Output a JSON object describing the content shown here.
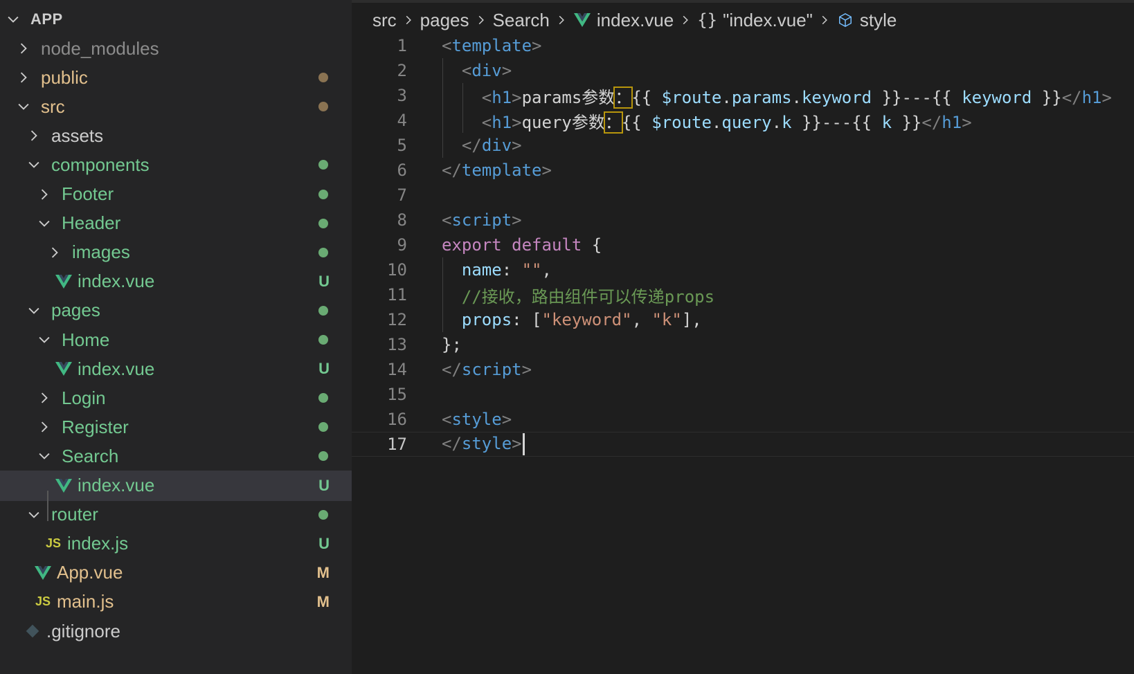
{
  "colors": {
    "untracked_green": "#73c991",
    "modified_tan": "#e2c08d",
    "folder_dot_brown": "#8a7352",
    "selected_bg": "#37373d",
    "vue_green": "#41b883"
  },
  "explorer": {
    "root_label": "APP",
    "items": [
      {
        "label": "node_modules",
        "kind": "folder",
        "expanded": false,
        "depth": 1,
        "color": "#8c8c8c",
        "icon": "chevron-right-icon"
      },
      {
        "label": "public",
        "kind": "folder",
        "expanded": false,
        "depth": 1,
        "color": "#e2c08d",
        "dot": "#8a7352"
      },
      {
        "label": "src",
        "kind": "folder",
        "expanded": true,
        "depth": 1,
        "color": "#e2c08d",
        "dot": "#8a7352"
      },
      {
        "label": "assets",
        "kind": "folder",
        "expanded": false,
        "depth": 2,
        "color": "#cccccc"
      },
      {
        "label": "components",
        "kind": "folder",
        "expanded": true,
        "depth": 2,
        "color": "#73c991",
        "dot": "#6aab73"
      },
      {
        "label": "Footer",
        "kind": "folder",
        "expanded": false,
        "depth": 3,
        "color": "#73c991",
        "dot": "#6aab73"
      },
      {
        "label": "Header",
        "kind": "folder",
        "expanded": true,
        "depth": 3,
        "color": "#73c991",
        "dot": "#6aab73"
      },
      {
        "label": "images",
        "kind": "folder",
        "expanded": false,
        "depth": 4,
        "color": "#73c991",
        "dot": "#6aab73"
      },
      {
        "label": "index.vue",
        "kind": "vue",
        "depth": 4,
        "color": "#73c991",
        "badge": "U"
      },
      {
        "label": "pages",
        "kind": "folder",
        "expanded": true,
        "depth": 2,
        "color": "#73c991",
        "dot": "#6aab73"
      },
      {
        "label": "Home",
        "kind": "folder",
        "expanded": true,
        "depth": 3,
        "color": "#73c991",
        "dot": "#6aab73"
      },
      {
        "label": "index.vue",
        "kind": "vue",
        "depth": 4,
        "color": "#73c991",
        "badge": "U"
      },
      {
        "label": "Login",
        "kind": "folder",
        "expanded": false,
        "depth": 3,
        "color": "#73c991",
        "dot": "#6aab73"
      },
      {
        "label": "Register",
        "kind": "folder",
        "expanded": false,
        "depth": 3,
        "color": "#73c991",
        "dot": "#6aab73"
      },
      {
        "label": "Search",
        "kind": "folder",
        "expanded": true,
        "depth": 3,
        "color": "#73c991",
        "dot": "#6aab73"
      },
      {
        "label": "index.vue",
        "kind": "vue",
        "depth": 4,
        "color": "#73c991",
        "badge": "U",
        "selected": true
      },
      {
        "label": "router",
        "kind": "folder",
        "expanded": true,
        "depth": 2,
        "color": "#73c991",
        "dot": "#6aab73"
      },
      {
        "label": "index.js",
        "kind": "js",
        "depth": 3,
        "color": "#73c991",
        "badge": "U"
      },
      {
        "label": "App.vue",
        "kind": "vue",
        "depth": 2,
        "color": "#e2c08d",
        "badge": "M"
      },
      {
        "label": "main.js",
        "kind": "js",
        "depth": 2,
        "color": "#e2c08d",
        "badge": "M"
      },
      {
        "label": ".gitignore",
        "kind": "git",
        "depth": 1,
        "color": "#cccccc"
      }
    ]
  },
  "breadcrumb": {
    "items": [
      {
        "label": "src",
        "icon": ""
      },
      {
        "label": "pages",
        "icon": ""
      },
      {
        "label": "Search",
        "icon": ""
      },
      {
        "label": "index.vue",
        "icon": "vue-icon"
      },
      {
        "label": "\"index.vue\"",
        "icon": "braces-icon"
      },
      {
        "label": "style",
        "icon": "cube-icon"
      }
    ]
  },
  "editor": {
    "current_line": 17,
    "lines": [
      {
        "n": "1",
        "tokens": [
          [
            "<",
            "t-punct"
          ],
          [
            "template",
            "t-tag"
          ],
          [
            ">",
            "t-punct"
          ]
        ]
      },
      {
        "n": "2",
        "tokens": [
          [
            "  ",
            "t-text"
          ],
          [
            "<",
            "t-punct"
          ],
          [
            "div",
            "t-tag"
          ],
          [
            ">",
            "t-punct"
          ]
        ]
      },
      {
        "n": "3",
        "tokens": [
          [
            "    ",
            "t-text"
          ],
          [
            "<",
            "t-punct"
          ],
          [
            "h1",
            "t-tag"
          ],
          [
            ">",
            "t-punct"
          ],
          [
            "params参数",
            "t-text"
          ],
          [
            "：",
            "t-text hl"
          ],
          [
            "{{ ",
            "t-brace"
          ],
          [
            "$route",
            "t-var"
          ],
          [
            ".",
            "t-text"
          ],
          [
            "params",
            "t-var"
          ],
          [
            ".",
            "t-text"
          ],
          [
            "keyword",
            "t-var"
          ],
          [
            " }}---{{ ",
            "t-brace"
          ],
          [
            "keyword",
            "t-var"
          ],
          [
            " }}",
            "t-brace"
          ],
          [
            "</",
            "t-punct"
          ],
          [
            "h1",
            "t-tag"
          ],
          [
            ">",
            "t-punct"
          ]
        ]
      },
      {
        "n": "4",
        "tokens": [
          [
            "    ",
            "t-text"
          ],
          [
            "<",
            "t-punct"
          ],
          [
            "h1",
            "t-tag"
          ],
          [
            ">",
            "t-punct"
          ],
          [
            "query参数",
            "t-text"
          ],
          [
            "：",
            "t-text hl"
          ],
          [
            "{{ ",
            "t-brace"
          ],
          [
            "$route",
            "t-var"
          ],
          [
            ".",
            "t-text"
          ],
          [
            "query",
            "t-var"
          ],
          [
            ".",
            "t-text"
          ],
          [
            "k",
            "t-var"
          ],
          [
            " }}---{{ ",
            "t-brace"
          ],
          [
            "k",
            "t-var"
          ],
          [
            " }}",
            "t-brace"
          ],
          [
            "</",
            "t-punct"
          ],
          [
            "h1",
            "t-tag"
          ],
          [
            ">",
            "t-punct"
          ]
        ]
      },
      {
        "n": "5",
        "tokens": [
          [
            "  ",
            "t-text"
          ],
          [
            "</",
            "t-punct"
          ],
          [
            "div",
            "t-tag"
          ],
          [
            ">",
            "t-punct"
          ]
        ]
      },
      {
        "n": "6",
        "tokens": [
          [
            "</",
            "t-punct"
          ],
          [
            "template",
            "t-tag"
          ],
          [
            ">",
            "t-punct"
          ]
        ]
      },
      {
        "n": "7",
        "tokens": []
      },
      {
        "n": "8",
        "tokens": [
          [
            "<",
            "t-punct"
          ],
          [
            "script",
            "t-tag"
          ],
          [
            ">",
            "t-punct"
          ]
        ]
      },
      {
        "n": "9",
        "tokens": [
          [
            "export",
            "t-kw"
          ],
          [
            " ",
            "t-text"
          ],
          [
            "default",
            "t-kw"
          ],
          [
            " {",
            "t-brace"
          ]
        ]
      },
      {
        "n": "10",
        "tokens": [
          [
            "  ",
            "t-text"
          ],
          [
            "name",
            "t-var"
          ],
          [
            ": ",
            "t-text"
          ],
          [
            "\"\"",
            "t-str"
          ],
          [
            ",",
            "t-text"
          ]
        ]
      },
      {
        "n": "11",
        "tokens": [
          [
            "  ",
            "t-text"
          ],
          [
            "//接收，路由组件可以传递props",
            "t-cmt"
          ]
        ]
      },
      {
        "n": "12",
        "tokens": [
          [
            "  ",
            "t-text"
          ],
          [
            "props",
            "t-var"
          ],
          [
            ": [",
            "t-text"
          ],
          [
            "\"keyword\"",
            "t-str"
          ],
          [
            ", ",
            "t-text"
          ],
          [
            "\"k\"",
            "t-str"
          ],
          [
            "],",
            "t-text"
          ]
        ]
      },
      {
        "n": "13",
        "tokens": [
          [
            "};",
            "t-text"
          ]
        ]
      },
      {
        "n": "14",
        "tokens": [
          [
            "</",
            "t-punct"
          ],
          [
            "script",
            "t-tag"
          ],
          [
            ">",
            "t-punct"
          ]
        ]
      },
      {
        "n": "15",
        "tokens": []
      },
      {
        "n": "16",
        "tokens": [
          [
            "<",
            "t-punct"
          ],
          [
            "style",
            "t-tag"
          ],
          [
            ">",
            "t-punct"
          ]
        ]
      },
      {
        "n": "17",
        "tokens": [
          [
            "</",
            "t-punct"
          ],
          [
            "style",
            "t-tag"
          ],
          [
            ">",
            "t-punct"
          ]
        ]
      }
    ]
  }
}
